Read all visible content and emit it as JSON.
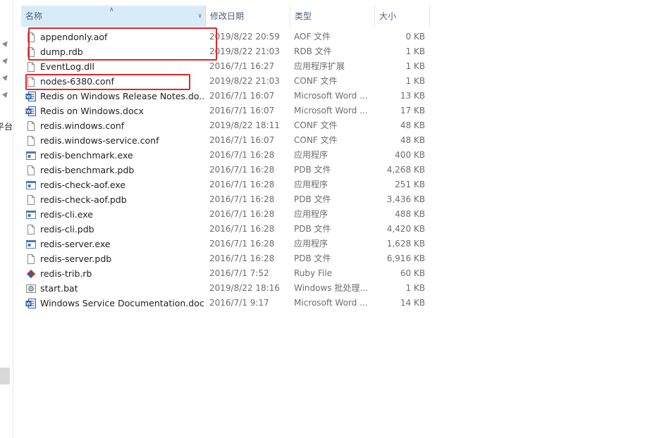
{
  "header": {
    "name": "名称",
    "date_modified": "修改日期",
    "type": "类型",
    "size": "大小"
  },
  "nav": {
    "cut_text": "平台"
  },
  "files": [
    {
      "name": "appendonly.aof",
      "date": "2019/8/22 20:59",
      "type": "AOF 文件",
      "size": "0 KB",
      "icon": "blank-file-icon"
    },
    {
      "name": "dump.rdb",
      "date": "2019/8/22 21:03",
      "type": "RDB 文件",
      "size": "1 KB",
      "icon": "blank-file-icon"
    },
    {
      "name": "EventLog.dll",
      "date": "2016/7/1 16:27",
      "type": "应用程序扩展",
      "size": "1 KB",
      "icon": "blank-file-icon"
    },
    {
      "name": "nodes-6380.conf",
      "date": "2019/8/22 21:03",
      "type": "CONF 文件",
      "size": "1 KB",
      "icon": "blank-file-icon"
    },
    {
      "name": "Redis on Windows Release Notes.do...",
      "date": "2016/7/1 16:07",
      "type": "Microsoft Word ...",
      "size": "13 KB",
      "icon": "word-doc-icon"
    },
    {
      "name": "Redis on Windows.docx",
      "date": "2016/7/1 16:07",
      "type": "Microsoft Word ...",
      "size": "17 KB",
      "icon": "word-doc-icon"
    },
    {
      "name": "redis.windows.conf",
      "date": "2019/8/22 18:11",
      "type": "CONF 文件",
      "size": "48 KB",
      "icon": "blank-file-icon"
    },
    {
      "name": "redis.windows-service.conf",
      "date": "2016/7/1 16:07",
      "type": "CONF 文件",
      "size": "48 KB",
      "icon": "blank-file-icon"
    },
    {
      "name": "redis-benchmark.exe",
      "date": "2016/7/1 16:28",
      "type": "应用程序",
      "size": "400 KB",
      "icon": "exe-app-icon"
    },
    {
      "name": "redis-benchmark.pdb",
      "date": "2016/7/1 16:28",
      "type": "PDB 文件",
      "size": "4,268 KB",
      "icon": "blank-file-icon"
    },
    {
      "name": "redis-check-aof.exe",
      "date": "2016/7/1 16:28",
      "type": "应用程序",
      "size": "251 KB",
      "icon": "exe-app-icon"
    },
    {
      "name": "redis-check-aof.pdb",
      "date": "2016/7/1 16:28",
      "type": "PDB 文件",
      "size": "3,436 KB",
      "icon": "blank-file-icon"
    },
    {
      "name": "redis-cli.exe",
      "date": "2016/7/1 16:28",
      "type": "应用程序",
      "size": "488 KB",
      "icon": "exe-app-icon"
    },
    {
      "name": "redis-cli.pdb",
      "date": "2016/7/1 16:28",
      "type": "PDB 文件",
      "size": "4,420 KB",
      "icon": "blank-file-icon"
    },
    {
      "name": "redis-server.exe",
      "date": "2016/7/1 16:28",
      "type": "应用程序",
      "size": "1,628 KB",
      "icon": "exe-app-icon"
    },
    {
      "name": "redis-server.pdb",
      "date": "2016/7/1 16:28",
      "type": "PDB 文件",
      "size": "6,916 KB",
      "icon": "blank-file-icon"
    },
    {
      "name": "redis-trib.rb",
      "date": "2016/7/1 7:52",
      "type": "Ruby File",
      "size": "60 KB",
      "icon": "ruby-file-icon"
    },
    {
      "name": "start.bat",
      "date": "2019/8/22 18:16",
      "type": "Windows 批处理...",
      "size": "1 KB",
      "icon": "batch-file-icon"
    },
    {
      "name": "Windows Service Documentation.docx",
      "date": "2016/7/1 9:17",
      "type": "Microsoft Word ...",
      "size": "14 KB",
      "icon": "word-doc-icon"
    }
  ],
  "colors": {
    "highlight": "#e0272b",
    "header_selected": "#d9ebf9",
    "header_text": "#4c607a",
    "word_blue": "#2b579a"
  }
}
